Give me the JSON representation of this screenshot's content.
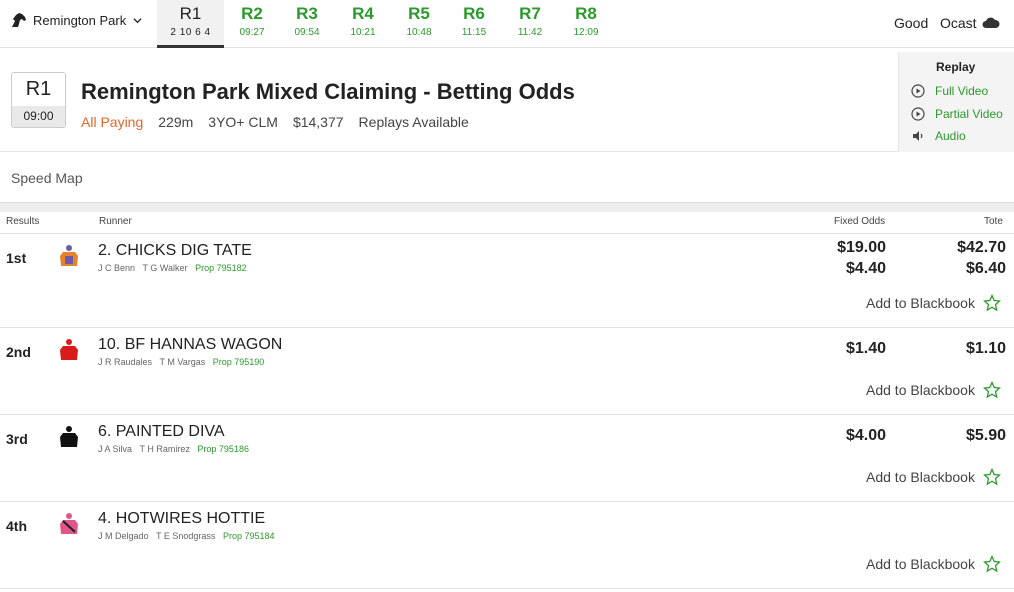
{
  "venue": {
    "name": "Remington Park",
    "icon": "horse-head-icon"
  },
  "races": [
    {
      "num": "R1",
      "time": "2 10 6 4",
      "active": true
    },
    {
      "num": "R2",
      "time": "09:27"
    },
    {
      "num": "R3",
      "time": "09:54"
    },
    {
      "num": "R4",
      "time": "10:21"
    },
    {
      "num": "R5",
      "time": "10:48"
    },
    {
      "num": "R6",
      "time": "11:15"
    },
    {
      "num": "R7",
      "time": "11:42"
    },
    {
      "num": "R8",
      "time": "12:09"
    }
  ],
  "track": {
    "condition": "Good",
    "ocast_label": "Ocast",
    "ocast_icon": "cloud-icon"
  },
  "race": {
    "number": "R1",
    "time": "09:00",
    "title": "Remington Park Mixed Claiming - Betting Odds",
    "status": "All Paying",
    "distance": "229m",
    "class": "3YO+ CLM",
    "prize": "$14,377",
    "replays": "Replays Available"
  },
  "replay": {
    "title": "Replay",
    "full_video": "Full Video",
    "partial_video": "Partial Video",
    "audio": "Audio"
  },
  "speed_map": {
    "label": "Speed Map"
  },
  "table": {
    "headers": {
      "results": "Results",
      "runner": "Runner",
      "fixed_odds": "Fixed Odds",
      "tote": "Tote"
    },
    "blackbook_label": "Add to Blackbook",
    "rows": [
      {
        "place": "1st",
        "runner": "2. CHICKS DIG TATE",
        "jockey": "J C Benn",
        "trainer": "T G Walker",
        "prop": "Prop 795182",
        "fixed_win": "$19.00",
        "fixed_place": "$4.40",
        "tote_win": "$42.70",
        "tote_place": "$6.40",
        "silk_color": "#e8822a",
        "silk_accent": "#6b5aa8"
      },
      {
        "place": "2nd",
        "runner": "10. BF HANNAS WAGON",
        "jockey": "J R Raudales",
        "trainer": "T M Vargas",
        "prop": "Prop 795190",
        "fixed_win": "$1.40",
        "tote_win": "$1.10",
        "silk_color": "#d81c1c",
        "silk_accent": "#d81c1c"
      },
      {
        "place": "3rd",
        "runner": "6. PAINTED DIVA",
        "jockey": "J A Silva",
        "trainer": "T H Ramirez",
        "prop": "Prop 795186",
        "fixed_win": "$4.00",
        "tote_win": "$5.90",
        "silk_color": "#111111",
        "silk_accent": "#111111"
      },
      {
        "place": "4th",
        "runner": "4. HOTWIRES HOTTIE",
        "jockey": "J M Delgado",
        "trainer": "T E Snodgrass",
        "prop": "Prop 795184",
        "silk_color": "#e0568a",
        "silk_accent": "#222222"
      }
    ]
  },
  "colors": {
    "accent_green": "#2d9a2d",
    "paying_orange": "#e1662a"
  }
}
